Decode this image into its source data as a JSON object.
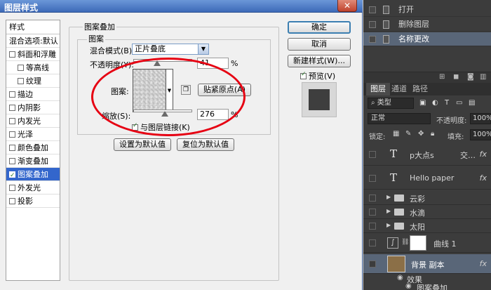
{
  "dialog": {
    "title": "图层样式",
    "close": "✕",
    "styles_header": "样式",
    "blend_options": "混合选项:默认",
    "styles": [
      {
        "label": "斜面和浮雕",
        "checked": false,
        "indent": false
      },
      {
        "label": "等高线",
        "checked": false,
        "indent": true
      },
      {
        "label": "纹理",
        "checked": false,
        "indent": true
      },
      {
        "label": "描边",
        "checked": false,
        "indent": false
      },
      {
        "label": "内阴影",
        "checked": false,
        "indent": false
      },
      {
        "label": "内发光",
        "checked": false,
        "indent": false
      },
      {
        "label": "光泽",
        "checked": false,
        "indent": false
      },
      {
        "label": "颜色叠加",
        "checked": false,
        "indent": false
      },
      {
        "label": "渐变叠加",
        "checked": false,
        "indent": false
      },
      {
        "label": "图案叠加",
        "checked": true,
        "indent": false,
        "selected": true
      },
      {
        "label": "外发光",
        "checked": false,
        "indent": false
      },
      {
        "label": "投影",
        "checked": false,
        "indent": false
      }
    ],
    "section_title": "图案叠加",
    "subsection_title": "图案",
    "blend_mode_label": "混合模式(B):",
    "blend_mode_value": "正片叠底",
    "opacity_label": "不透明度(Y):",
    "opacity_value": "41",
    "opacity_unit": "%",
    "opacity_fraction": 0.41,
    "pattern_label": "图案:",
    "snap_origin_button": "贴紧原点(A)",
    "scale_label": "缩放(S):",
    "scale_value": "276",
    "scale_unit": "%",
    "scale_fraction": 0.53,
    "link_label": "与图层链接(K)",
    "link_checked": true,
    "make_default": "设置为默认值",
    "reset_default": "复位为默认值",
    "ok": "确定",
    "cancel": "取消",
    "new_style": "新建样式(W)...",
    "preview_label": "预览(V)",
    "preview_checked": true
  },
  "history": {
    "items": [
      {
        "label": "打开",
        "selected": false
      },
      {
        "label": "删除图层",
        "selected": false
      },
      {
        "label": "名称更改",
        "selected": true
      }
    ]
  },
  "layers_panel": {
    "tabs": [
      "图层",
      "通道",
      "路径"
    ],
    "filter_label": "类型",
    "blend_value": "正常",
    "opacity_label": "不透明度:",
    "opacity_value": "100%",
    "lock_label": "锁定:",
    "fill_label": "填充:",
    "fill_value": "100%",
    "layers": [
      {
        "kind": "text",
        "name": "p大点s",
        "suffix": "交…",
        "fx": "fx"
      },
      {
        "kind": "text",
        "name": "Hello paper",
        "fx": "fx"
      },
      {
        "kind": "folder",
        "name": "云彩"
      },
      {
        "kind": "folder",
        "name": "水滴"
      },
      {
        "kind": "folder",
        "name": "太阳"
      },
      {
        "kind": "curves",
        "name": "曲线 1"
      },
      {
        "kind": "image",
        "name": "背景 副本",
        "fx": "fx",
        "selected": true
      }
    ],
    "effects_label": "效果",
    "effect_item": "图案叠加"
  },
  "colors": {
    "accent": "#3366cc",
    "ellipse": "#e60012",
    "layer_thumb": "#8b6f47"
  }
}
